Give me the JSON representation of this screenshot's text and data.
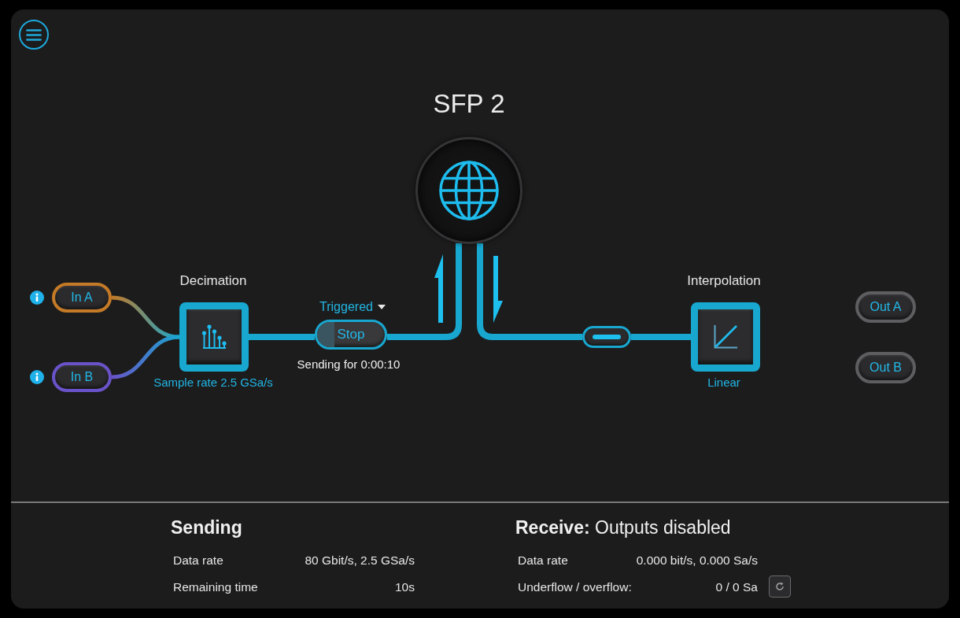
{
  "title": "SFP 2",
  "inputs": [
    {
      "label": "In A",
      "color": "#c47a26"
    },
    {
      "label": "In B",
      "color": "#6a52c8"
    }
  ],
  "decimation": {
    "title": "Decimation",
    "caption": "Sample rate 2.5 GSa/s"
  },
  "trigger": {
    "mode": "Triggered",
    "action": "Stop",
    "level": 0.25,
    "status": "Sending for 0:00:10"
  },
  "link_toggle": {
    "on": true
  },
  "interpolation": {
    "title": "Interpolation",
    "caption": "Linear"
  },
  "outputs": [
    {
      "label": "Out A",
      "disabled": true
    },
    {
      "label": "Out B",
      "disabled": true
    }
  ],
  "sending": {
    "title": "Sending",
    "rows": [
      {
        "label": "Data rate",
        "value": "80 Gbit/s, 2.5 GSa/s"
      },
      {
        "label": "Remaining time",
        "value": "10s"
      }
    ]
  },
  "receive": {
    "title": "**Receive:** Outputs disabled",
    "rows": [
      {
        "label": "Data rate",
        "value": "0.000 bit/s, 0.000 Sa/s"
      },
      {
        "label": "Underflow / overflow:",
        "value": "0 / 0 Sa"
      }
    ]
  }
}
